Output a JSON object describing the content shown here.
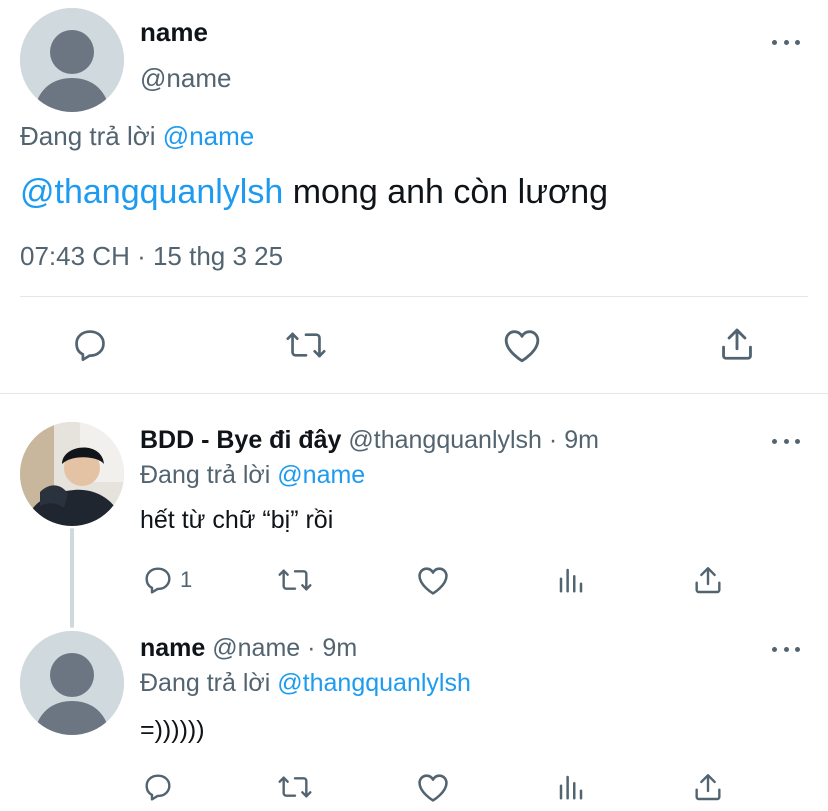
{
  "main_tweet": {
    "display_name": "name",
    "handle": "@name",
    "replying_prefix": "Đang trả lời",
    "replying_to": "@name",
    "mention": "@thangquanlylsh",
    "text": " mong anh còn lương",
    "timestamp": "07:43 CH · 15 thg 3 25",
    "actions": [
      "reply-icon",
      "retweet-icon",
      "like-icon",
      "share-icon"
    ]
  },
  "replies": [
    {
      "display_name": "BDD - Bye đi đây",
      "handle": "@thangquanlylsh",
      "time": "· 9m",
      "replying_prefix": "Đang trả lời",
      "replying_to": "@name",
      "text": "hết từ chữ “bị” rồi",
      "reply_count": "1",
      "actions": [
        "reply-icon",
        "retweet-icon",
        "like-icon",
        "analytics-icon",
        "share-icon"
      ]
    },
    {
      "display_name": "name",
      "handle": "@name",
      "time": "· 9m",
      "replying_prefix": "Đang trả lời",
      "replying_to": "@thangquanlylsh",
      "text": "=))))))",
      "reply_count": "",
      "actions": [
        "reply-icon",
        "retweet-icon",
        "like-icon",
        "analytics-icon",
        "share-icon"
      ]
    }
  ],
  "colors": {
    "link": "#1d9bf0",
    "secondary_text": "#536471",
    "avatar_bg": "#cfd9de",
    "avatar_figure": "#6b7682"
  }
}
